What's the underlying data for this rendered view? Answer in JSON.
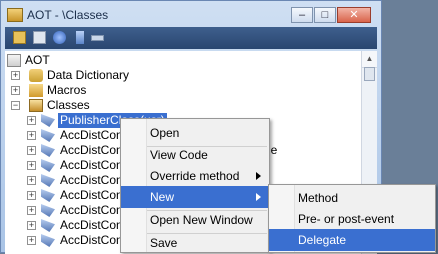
{
  "window": {
    "title": "AOT - \\Classes"
  },
  "title_buttons": {
    "minimize": "–",
    "maximize": "□",
    "close": "✕"
  },
  "toolbar": {
    "icons": [
      "open-folder-icon",
      "properties-icon",
      "compile-icon",
      "import-icon",
      "find-icon"
    ]
  },
  "tree": {
    "root": "AOT",
    "nodes": [
      {
        "label": "Data Dictionary",
        "expander": "+"
      },
      {
        "label": "Macros",
        "expander": "+"
      },
      {
        "label": "Classes",
        "expander": "−"
      }
    ],
    "classes": [
      "PublisherClass(usr)",
      "AccDistCons",
      "AccDistCons",
      "AccDistCons",
      "AccDistCons",
      "AccDistCons",
      "AccDistCons",
      "AccDistCons",
      "AccDistCons"
    ],
    "peek_text": "le"
  },
  "context_menu": {
    "items": [
      "Open",
      "View Code",
      "Override method",
      "New",
      "Open New Window",
      "Save"
    ]
  },
  "submenu": {
    "items": [
      "Method",
      "Pre- or post-event handler",
      "Delegate"
    ]
  },
  "colors": {
    "highlight": "#3a6fd0",
    "toolbar": "#2a4670"
  }
}
